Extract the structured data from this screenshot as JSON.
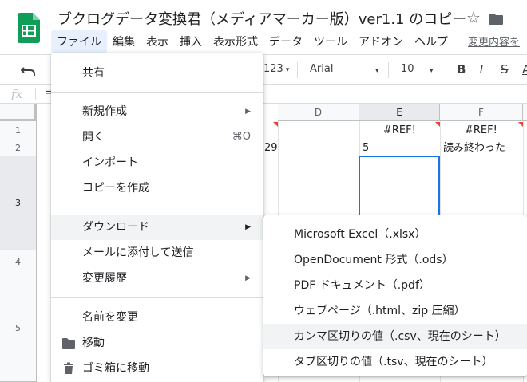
{
  "document": {
    "title": "ブクログデータ変換君（メディアマーカー版）ver1.1 のコピー",
    "last_edit_link": "変更内容を"
  },
  "menubar": [
    "ファイル",
    "編集",
    "表示",
    "挿入",
    "表示形式",
    "データ",
    "ツール",
    "アドオン",
    "ヘルプ"
  ],
  "toolbar": {
    "format_more": "123",
    "font": "Arial",
    "font_size": "10",
    "bold": "B",
    "italic": "I",
    "strikethrough": "S",
    "text_color": "A"
  },
  "formula_bar": {
    "fx_label": "fx",
    "content": "="
  },
  "grid": {
    "columns": [
      "D",
      "E",
      "F"
    ],
    "selected_column": "E",
    "rows": [
      "1",
      "2",
      "3",
      "4",
      "5"
    ],
    "selected_row": "3",
    "cells": {
      "C2": "29",
      "E1": "#REF!",
      "F1": "#REF!",
      "E2": "5",
      "F2": "読み終わった"
    }
  },
  "file_menu": {
    "share": "共有",
    "new": "新規作成",
    "open": "開く",
    "open_shortcut": "⌘O",
    "import": "インポート",
    "make_copy": "コピーを作成",
    "download": "ダウンロード",
    "email_attachment": "メールに添付して送信",
    "version_history": "変更履歴",
    "rename": "名前を変更",
    "move": "移動",
    "move_to_trash": "ゴミ箱に移動"
  },
  "download_submenu": [
    "Microsoft Excel（.xlsx）",
    "OpenDocument 形式（.ods）",
    "PDF ドキュメント（.pdf）",
    "ウェブページ（.html、zip 圧縮）",
    "カンマ区切りの値（.csv、現在のシート）",
    "タブ区切りの値（.tsv、現在のシート）"
  ],
  "colors": {
    "sheets_green": "#0f9d58",
    "selection_blue": "#1a73e8",
    "error_red": "#ea4335",
    "menu_highlight": "#f1f3f4"
  }
}
